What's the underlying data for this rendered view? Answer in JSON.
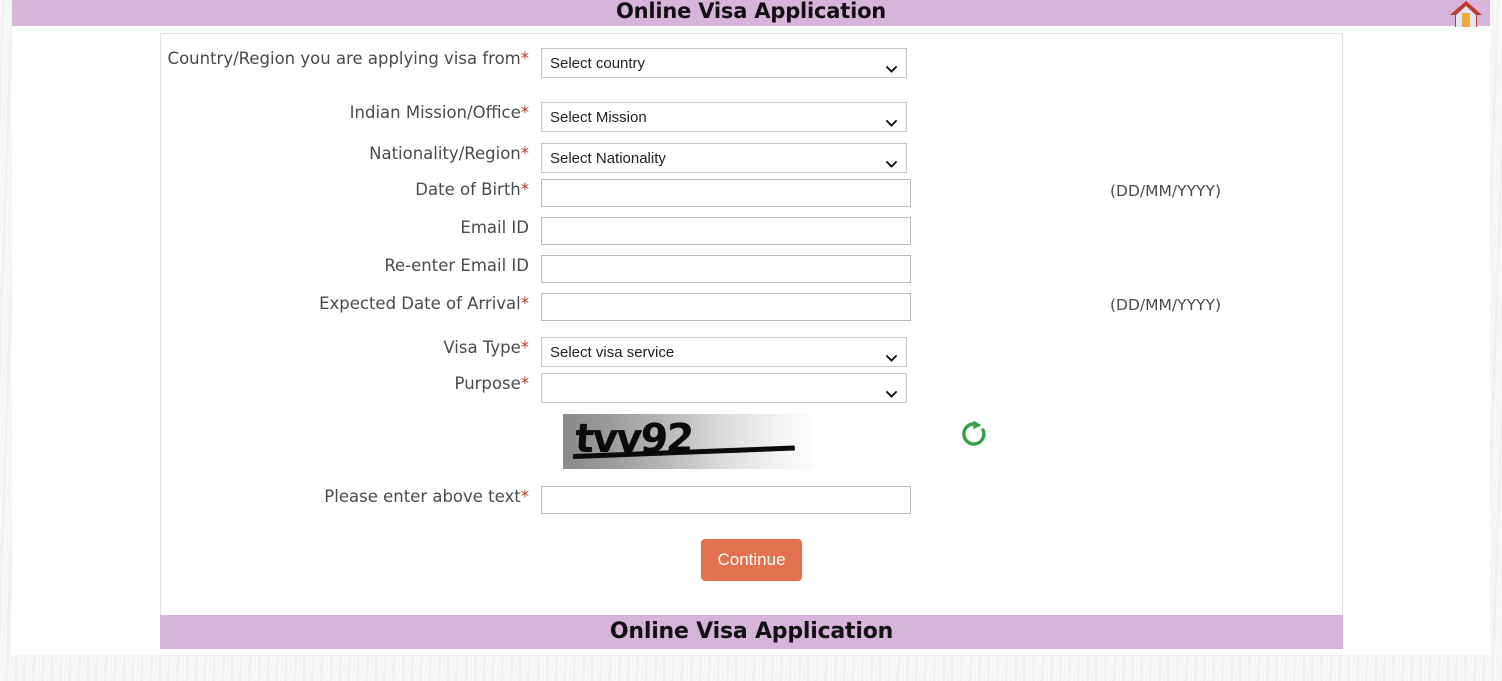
{
  "header": {
    "title": "Online Visa Application",
    "home_icon": "home-icon"
  },
  "footer": {
    "title": "Online Visa Application"
  },
  "form": {
    "rows": [
      {
        "label": "Country/Region you are applying visa from",
        "required": true,
        "control": "select",
        "value": "Select country",
        "hint": ""
      },
      {
        "label": "Indian Mission/Office",
        "required": true,
        "control": "select",
        "value": "Select Mission",
        "hint": ""
      },
      {
        "label": "Nationality/Region",
        "required": true,
        "control": "select",
        "value": "Select Nationality",
        "hint": ""
      },
      {
        "label": "Date of Birth",
        "required": true,
        "control": "text",
        "value": "",
        "hint": "(DD/MM/YYYY)"
      },
      {
        "label": "Email ID",
        "required": false,
        "control": "text",
        "value": "",
        "hint": ""
      },
      {
        "label": "Re-enter Email ID",
        "required": false,
        "control": "text",
        "value": "",
        "hint": ""
      },
      {
        "label": "Expected Date of Arrival",
        "required": true,
        "control": "text",
        "value": "",
        "hint": "(DD/MM/YYYY)"
      },
      {
        "label": "Visa Type",
        "required": true,
        "control": "select",
        "value": "Select visa service",
        "hint": ""
      },
      {
        "label": "Purpose",
        "required": true,
        "control": "select",
        "value": "",
        "hint": ""
      },
      {
        "label": "Please enter above text",
        "required": true,
        "control": "text",
        "value": "",
        "hint": ""
      }
    ]
  },
  "captcha": {
    "text": "tvv92",
    "refresh_icon": "refresh-icon",
    "refresh_color": "#35a047"
  },
  "actions": {
    "continue_label": "Continue",
    "continue_color": "#e2724f"
  },
  "colors": {
    "banner": "#d7b5db",
    "required_asterisk": "#c0392b",
    "label_text": "#4a4a4a"
  }
}
